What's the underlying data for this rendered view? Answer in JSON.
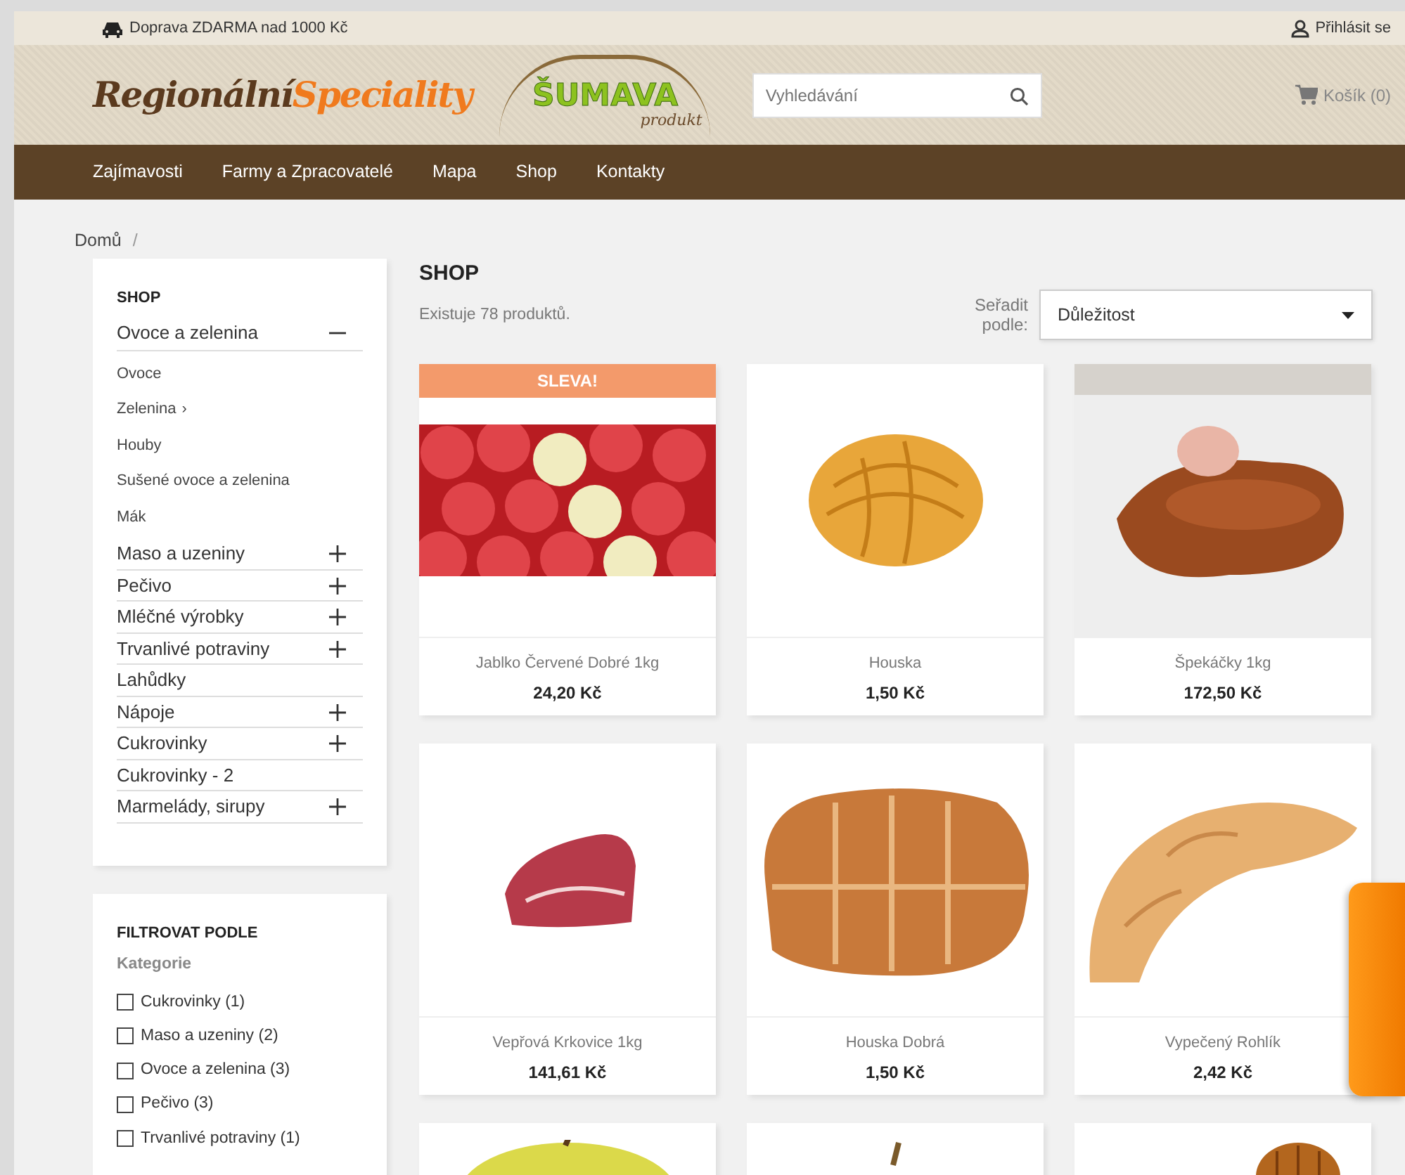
{
  "topbar": {
    "shipping": "Doprava ZDARMA nad 1000 Kč",
    "login": "Přihlásit se"
  },
  "header": {
    "logo_part1": "Regionální",
    "logo_part2": "Speciality",
    "brand": "ŠUMAVA",
    "brand_sub": "produkt",
    "search": {
      "placeholder": "Vyhledávání"
    },
    "cart": "Košík (0)"
  },
  "nav": [
    "Zajímavosti",
    "Farmy a Zpracovatelé",
    "Mapa",
    "Shop",
    "Kontakty"
  ],
  "breadcrumb": {
    "items": [
      "Domů"
    ],
    "separator": "/"
  },
  "sidebar": {
    "title": "SHOP",
    "categories": [
      {
        "label": "Ovoce a zelenina",
        "expandable": true,
        "expanded": true,
        "children": [
          {
            "label": "Ovoce"
          },
          {
            "label": "Zelenina",
            "marker": "›"
          },
          {
            "label": "Houby"
          },
          {
            "label": "Sušené ovoce a zelenina"
          },
          {
            "label": "Mák"
          }
        ]
      },
      {
        "label": "Maso a uzeniny",
        "expandable": true,
        "expanded": false
      },
      {
        "label": "Pečivo",
        "expandable": true,
        "expanded": false
      },
      {
        "label": "Mléčné výrobky",
        "expandable": true,
        "expanded": false
      },
      {
        "label": "Trvanlivé potraviny",
        "expandable": true,
        "expanded": false
      },
      {
        "label": "Lahůdky",
        "expandable": false,
        "expanded": false
      },
      {
        "label": "Nápoje",
        "expandable": true,
        "expanded": false
      },
      {
        "label": "Cukrovinky",
        "expandable": true,
        "expanded": false
      },
      {
        "label": "Cukrovinky - 2",
        "expandable": false,
        "expanded": false
      },
      {
        "label": "Marmelády, sirupy",
        "expandable": true,
        "expanded": false
      }
    ]
  },
  "filter": {
    "title": "FILTROVAT PODLE",
    "facet": "Kategorie",
    "options": [
      {
        "label": "Cukrovinky (1)",
        "checked": false
      },
      {
        "label": "Maso a uzeniny (2)",
        "checked": false
      },
      {
        "label": "Ovoce a zelenina (3)",
        "checked": false
      },
      {
        "label": "Pečivo (3)",
        "checked": false
      },
      {
        "label": "Trvanlivé potraviny (1)",
        "checked": false
      }
    ]
  },
  "shop": {
    "title": "SHOP",
    "count": "Existuje 78 produktů.",
    "sort_label": "Seřadit podle:",
    "sort_value": "Důležitost"
  },
  "products": [
    {
      "kind": "apples",
      "badge": "SLEVA!",
      "name": "Jablko Červené Dobré 1kg",
      "price": "24,20 Kč"
    },
    {
      "kind": "bun",
      "name": "Houska",
      "price": "1,50 Kč"
    },
    {
      "kind": "sausage",
      "name": "Špekáčky 1kg",
      "price": "172,50 Kč"
    },
    {
      "kind": "meat",
      "name": "Vepřová Krkovice 1kg",
      "price": "141,61 Kč"
    },
    {
      "kind": "bread",
      "name": "Houska Dobrá",
      "price": "1,50 Kč"
    },
    {
      "kind": "roll",
      "name": "Vypečený Rohlík",
      "price": "2,42 Kč"
    },
    {
      "kind": "apple"
    },
    {
      "kind": "pastry"
    },
    {
      "kind": "pumpkin"
    }
  ]
}
